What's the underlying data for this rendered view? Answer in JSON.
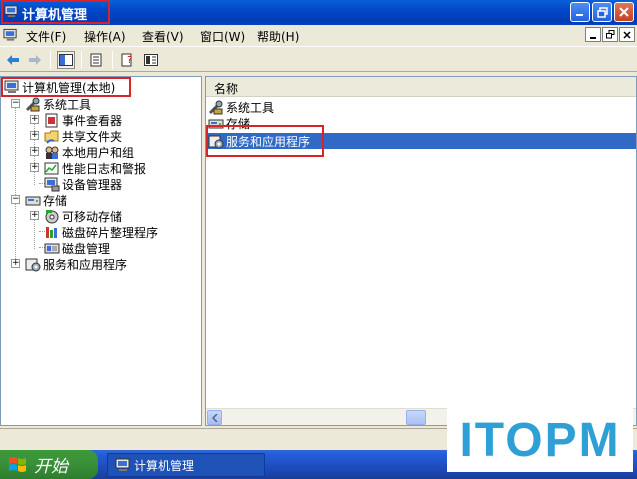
{
  "window": {
    "title": "计算机管理",
    "controls": [
      "minimize",
      "maximize",
      "close"
    ]
  },
  "menu": {
    "items": [
      {
        "label": "文件(F)"
      },
      {
        "label": "操作(A)"
      },
      {
        "label": "查看(V)"
      },
      {
        "label": "窗口(W)"
      },
      {
        "label": "帮助(H)"
      }
    ]
  },
  "toolbar": {
    "icons": [
      "back-arrow-icon",
      "forward-arrow-icon",
      "show-hide-tree-icon",
      "export-list-icon",
      "help-icon",
      "properties-icon"
    ]
  },
  "tree": {
    "root": "计算机管理(本地)",
    "nodes": [
      {
        "label": "系统工具",
        "level": 1
      },
      {
        "label": "事件查看器",
        "level": 2
      },
      {
        "label": "共享文件夹",
        "level": 2
      },
      {
        "label": "本地用户和组",
        "level": 2
      },
      {
        "label": "性能日志和警报",
        "level": 2
      },
      {
        "label": "设备管理器",
        "level": 2
      },
      {
        "label": "存储",
        "level": 1
      },
      {
        "label": "可移动存储",
        "level": 2
      },
      {
        "label": "磁盘碎片整理程序",
        "level": 2
      },
      {
        "label": "磁盘管理",
        "level": 2
      },
      {
        "label": "服务和应用程序",
        "level": 1
      }
    ]
  },
  "list": {
    "column_header": "名称",
    "rows": [
      {
        "label": "系统工具",
        "selected": false
      },
      {
        "label": "存储",
        "selected": false
      },
      {
        "label": "服务和应用程序",
        "selected": true
      }
    ]
  },
  "taskbar": {
    "start_label": "开始",
    "task_label": "计算机管理"
  },
  "watermark": {
    "text": "ITOPM"
  },
  "colors": {
    "highlight_box": "#d9232a",
    "selection": "#316ac5",
    "titlebar": "#0247c9",
    "watermark": "#2ea0d6"
  }
}
